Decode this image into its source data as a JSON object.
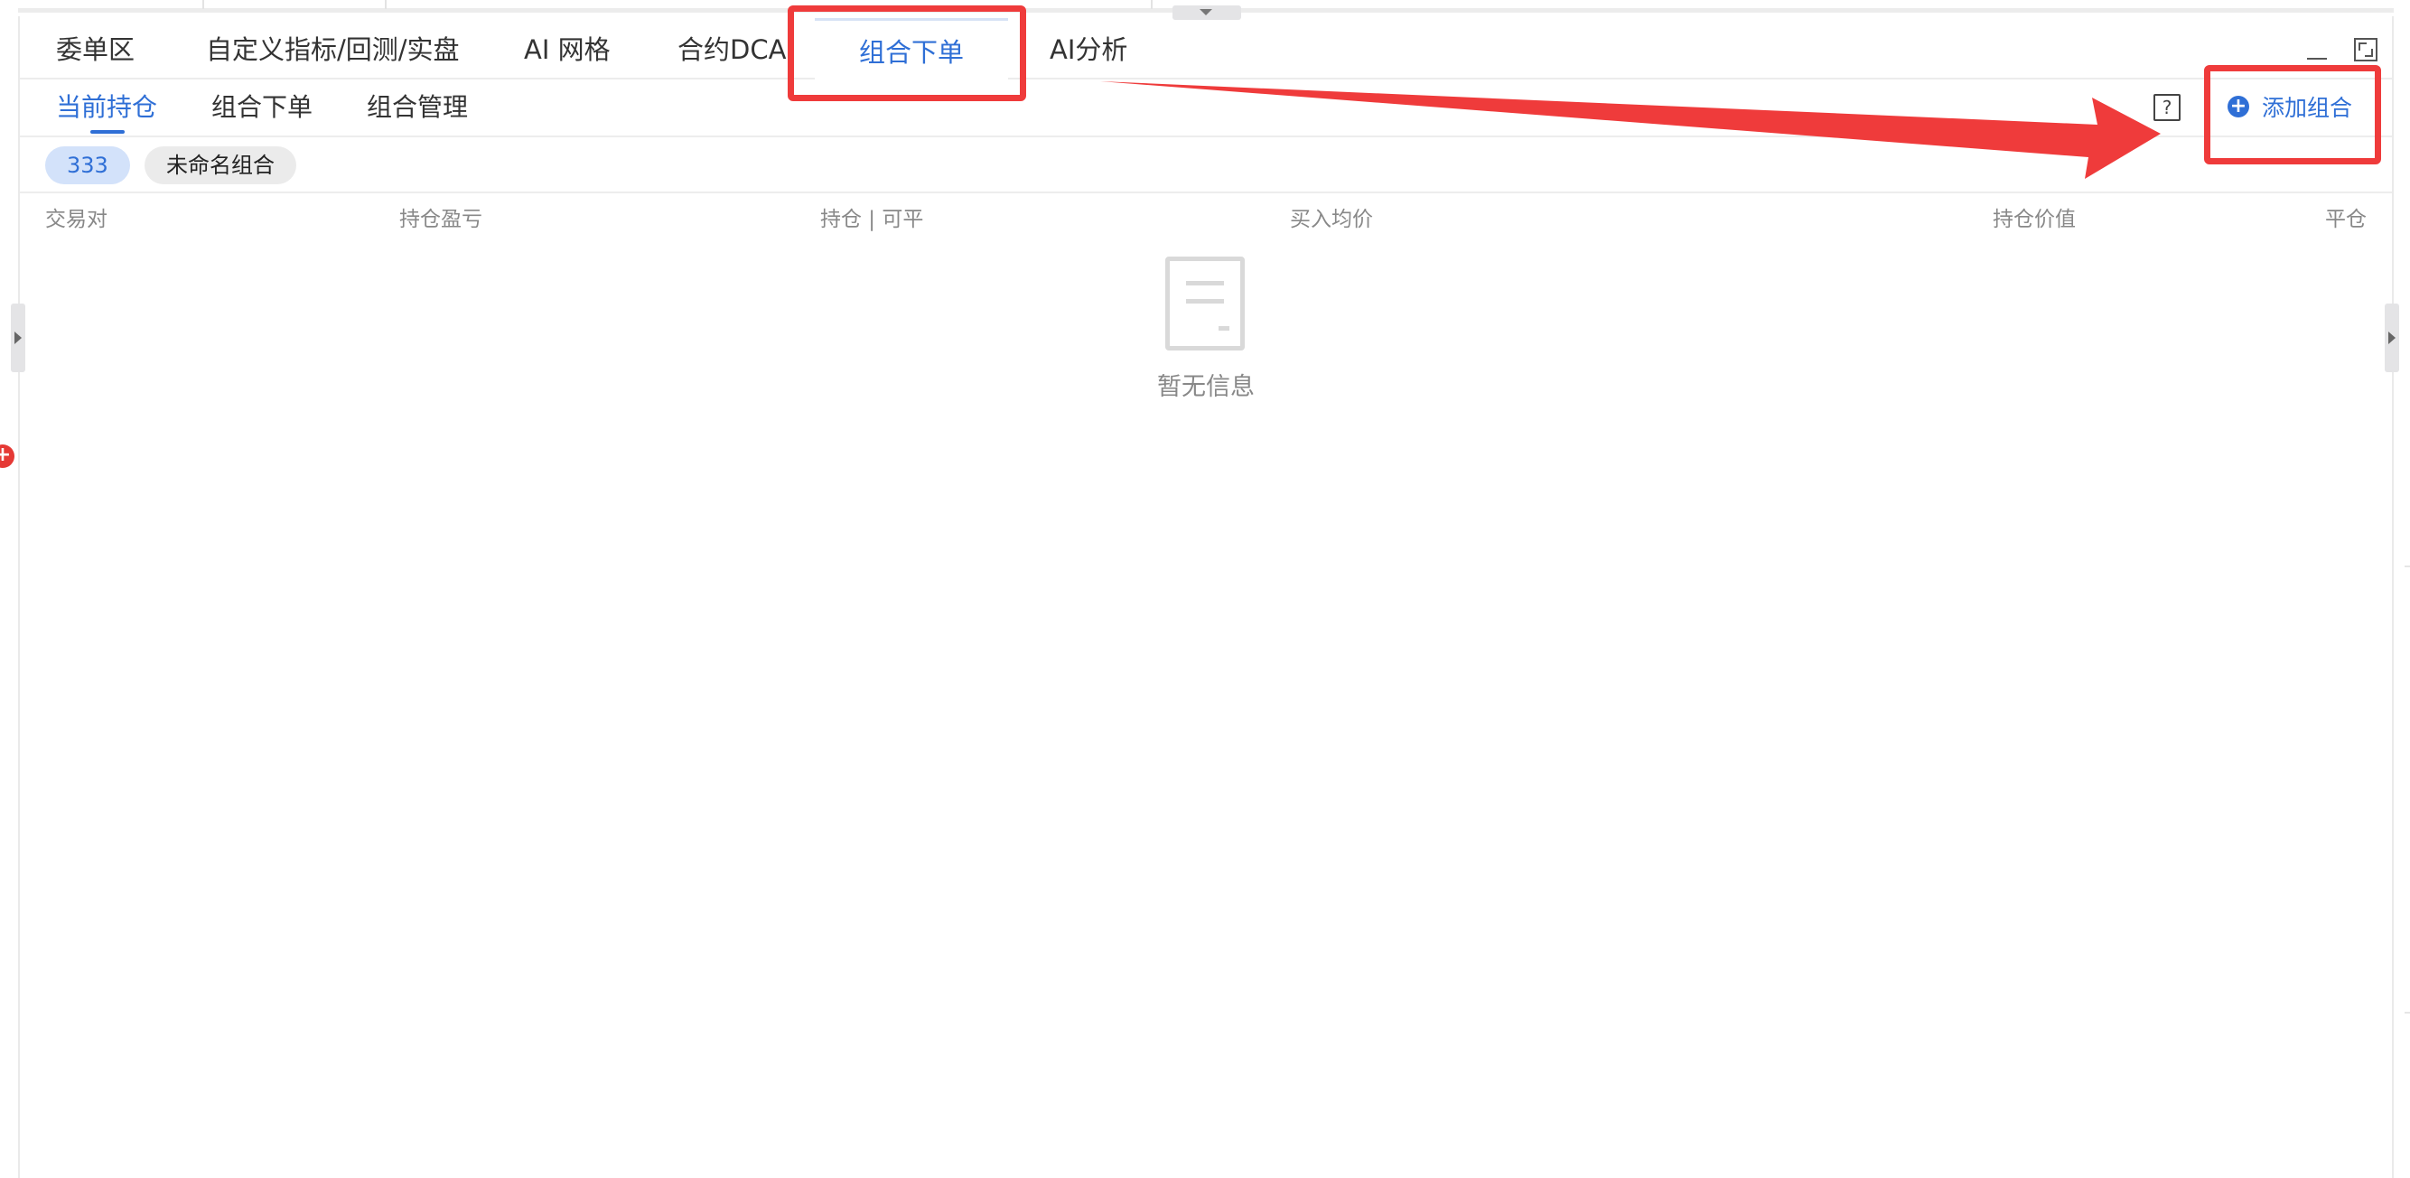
{
  "main_tabs": [
    {
      "label": "委单区"
    },
    {
      "label": "自定义指标/回测/实盘"
    },
    {
      "label": "AI 网格"
    },
    {
      "label": "合约DCA"
    },
    {
      "label": "组合下单"
    },
    {
      "label": "AI分析"
    }
  ],
  "active_main_tab": "组合下单",
  "sub_tabs": [
    {
      "label": "当前持仓"
    },
    {
      "label": "组合下单"
    },
    {
      "label": "组合管理"
    }
  ],
  "active_sub_tab": "当前持仓",
  "help_label": "?",
  "add_group_label": "添加组合",
  "groups": [
    {
      "label": "333",
      "selected": true
    },
    {
      "label": "未命名组合",
      "selected": false
    }
  ],
  "table": {
    "columns": [
      "交易对",
      "持仓盈亏",
      "持仓 | 可平",
      "买入均价",
      "持仓价值",
      "平仓"
    ],
    "rows": []
  },
  "empty_text": "暂无信息",
  "icons": [
    "plus-circle-icon",
    "help-icon",
    "minimize-icon",
    "maximize-icon",
    "empty-document-icon",
    "collapse-left-icon",
    "collapse-right-icon",
    "collapse-top-icon"
  ],
  "colors": {
    "accent": "#2f6fd6",
    "highlight": "#ef3b3b",
    "muted_text": "#888888"
  }
}
